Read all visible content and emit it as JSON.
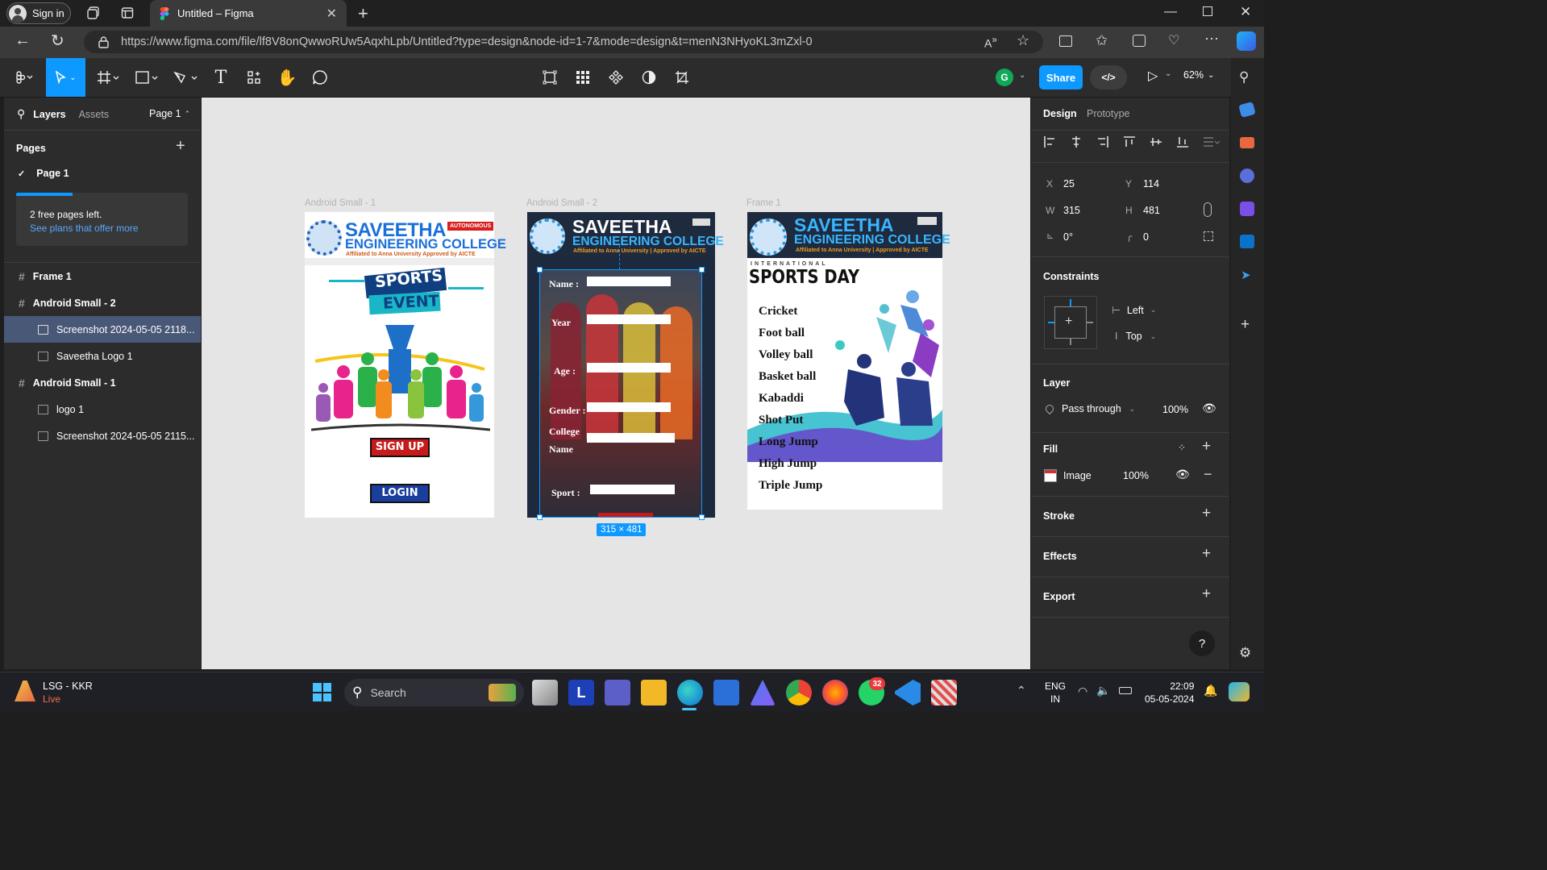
{
  "browser": {
    "signin_label": "Sign in",
    "tab_title": "Untitled – Figma",
    "url": "https://www.figma.com/file/lf8V8onQwwoRUw5AqxhLpb/Untitled?type=design&node-id=1-7&mode=design&t=menN3NHyoKL3mZxl-0"
  },
  "toolbar": {
    "share_label": "Share",
    "user_initial": "G",
    "zoom": "62%"
  },
  "left_panel": {
    "tab_layers": "Layers",
    "tab_assets": "Assets",
    "page_selector": "Page 1",
    "pages_heading": "Pages",
    "current_page": "Page 1",
    "free_pages_text": "2 free pages left.",
    "plans_link": "See plans that offer more",
    "layers": [
      {
        "name": "Frame 1",
        "type": "frame"
      },
      {
        "name": "Android Small - 2",
        "type": "frame"
      },
      {
        "name": "Screenshot 2024-05-05 2118...",
        "type": "image",
        "selected": true
      },
      {
        "name": "Saveetha Logo 1",
        "type": "image"
      },
      {
        "name": "Android Small - 1",
        "type": "frame"
      },
      {
        "name": "logo 1",
        "type": "image"
      },
      {
        "name": "Screenshot 2024-05-05 2115...",
        "type": "image"
      }
    ]
  },
  "canvas": {
    "frame1_label": "Android Small - 1",
    "frame2_label": "Android Small - 2",
    "frame3_label": "Frame 1",
    "selection_size": "315 × 481",
    "college_name_1": "SAVEETHA",
    "college_name_2": "ENGINEERING COLLEGE",
    "affiliation": "Affiliated to Anna University | Approved by AICTE",
    "affiliation_1": "Affiliated to Anna University  Approved by AICTE",
    "autonomous": "AUTONOMOUS",
    "sports_event_1": "SPORTS",
    "sports_event_2": "EVENT",
    "signup": "SIGN UP",
    "login": "LOGIN",
    "form_fields": [
      "Name :",
      "Year",
      "Age :",
      "Gender :",
      "College",
      "Name",
      "Sport :"
    ],
    "international": "INTERNATIONAL",
    "sports_day": "SPORTS DAY",
    "sports": [
      "Cricket",
      "Foot ball",
      "Volley ball",
      "Basket ball",
      "Kabaddi",
      "Shot Put",
      "Long Jump",
      "High Jump",
      "Triple Jump"
    ]
  },
  "right_panel": {
    "tab_design": "Design",
    "tab_prototype": "Prototype",
    "x_label": "X",
    "x": "25",
    "y_label": "Y",
    "y": "114",
    "w_label": "W",
    "w": "315",
    "h_label": "H",
    "h": "481",
    "rotation": "0°",
    "radius": "0",
    "constraints_title": "Constraints",
    "constraint_h": "Left",
    "constraint_v": "Top",
    "layer_title": "Layer",
    "blend_mode": "Pass through",
    "layer_opacity": "100%",
    "fill_title": "Fill",
    "fill_type": "Image",
    "fill_opacity": "100%",
    "stroke_title": "Stroke",
    "effects_title": "Effects",
    "export_title": "Export",
    "help": "?"
  },
  "taskbar": {
    "weather_title": "LSG - KKR",
    "weather_sub": "Live",
    "search_label": "Search",
    "whatsapp_badge": "32",
    "lang_1": "ENG",
    "lang_2": "IN",
    "time": "22:09",
    "date": "05-05-2024"
  }
}
